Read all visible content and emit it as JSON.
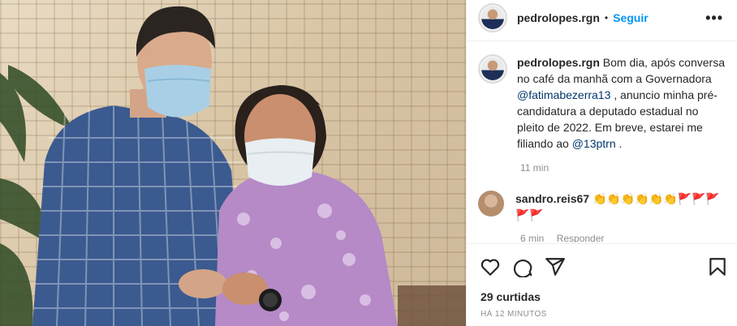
{
  "post": {
    "username": "pedrolopes.rgn",
    "follow_label": "Seguir",
    "separator": "•",
    "more_label": "•••",
    "caption": {
      "username": "pedrolopes.rgn",
      "text_1": " Bom dia, após conversa no café da manhã com a Governadora ",
      "mention_1": "@fatimabezerra13",
      "text_2": " , anuncio minha pré-candidatura a deputado estadual no pleito de 2022. Em breve, estarei me filiando ao ",
      "mention_2": "@13ptrn",
      "text_3": " .",
      "time": "11 min"
    },
    "comments": [
      {
        "username": "sandro.reis67",
        "text": " 👏👏👏👏👏👏🚩🚩🚩🚩🚩",
        "time": "6 min",
        "reply_label": "Responder"
      }
    ],
    "likes": "29 curtidas",
    "posted_ago": "HÁ 12 MINUTOS"
  },
  "icons": [
    "heart-icon",
    "comment-icon",
    "share-icon",
    "bookmark-icon",
    "more-options-icon"
  ],
  "colors": {
    "accent": "#0095f6",
    "mention": "#00376b",
    "muted": "#8e8e8e",
    "text": "#262626"
  }
}
